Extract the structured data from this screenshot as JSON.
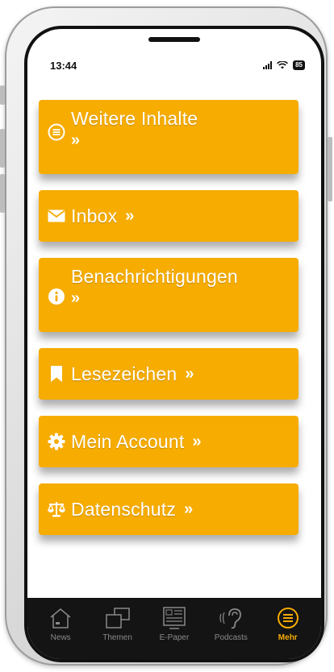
{
  "status": {
    "time": "13:44",
    "battery": "85"
  },
  "menu": {
    "items": [
      {
        "label": "Weitere Inhalte",
        "arrows": "»",
        "icon": "list-circle-icon"
      },
      {
        "label": "Inbox",
        "arrows": "»",
        "icon": "envelope-icon"
      },
      {
        "label": "Benachrichtigungen",
        "arrows": "»",
        "icon": "info-circle-icon"
      },
      {
        "label": "Lesezeichen",
        "arrows": "»",
        "icon": "bookmark-icon"
      },
      {
        "label": "Mein Account",
        "arrows": "»",
        "icon": "gear-icon"
      },
      {
        "label": "Datenschutz",
        "arrows": "»",
        "icon": "scales-icon"
      }
    ]
  },
  "tabs": [
    {
      "label": "News",
      "icon": "home-icon",
      "active": false
    },
    {
      "label": "Themen",
      "icon": "stacked-windows-icon",
      "active": false
    },
    {
      "label": "E-Paper",
      "icon": "newspaper-icon",
      "active": false
    },
    {
      "label": "Podcasts",
      "icon": "ear-icon",
      "active": false
    },
    {
      "label": "Mehr",
      "icon": "menu-circle-icon",
      "active": true
    }
  ],
  "colors": {
    "accent": "#f6ac00",
    "tabbar": "#141414",
    "inactive": "#8a8a8a"
  }
}
